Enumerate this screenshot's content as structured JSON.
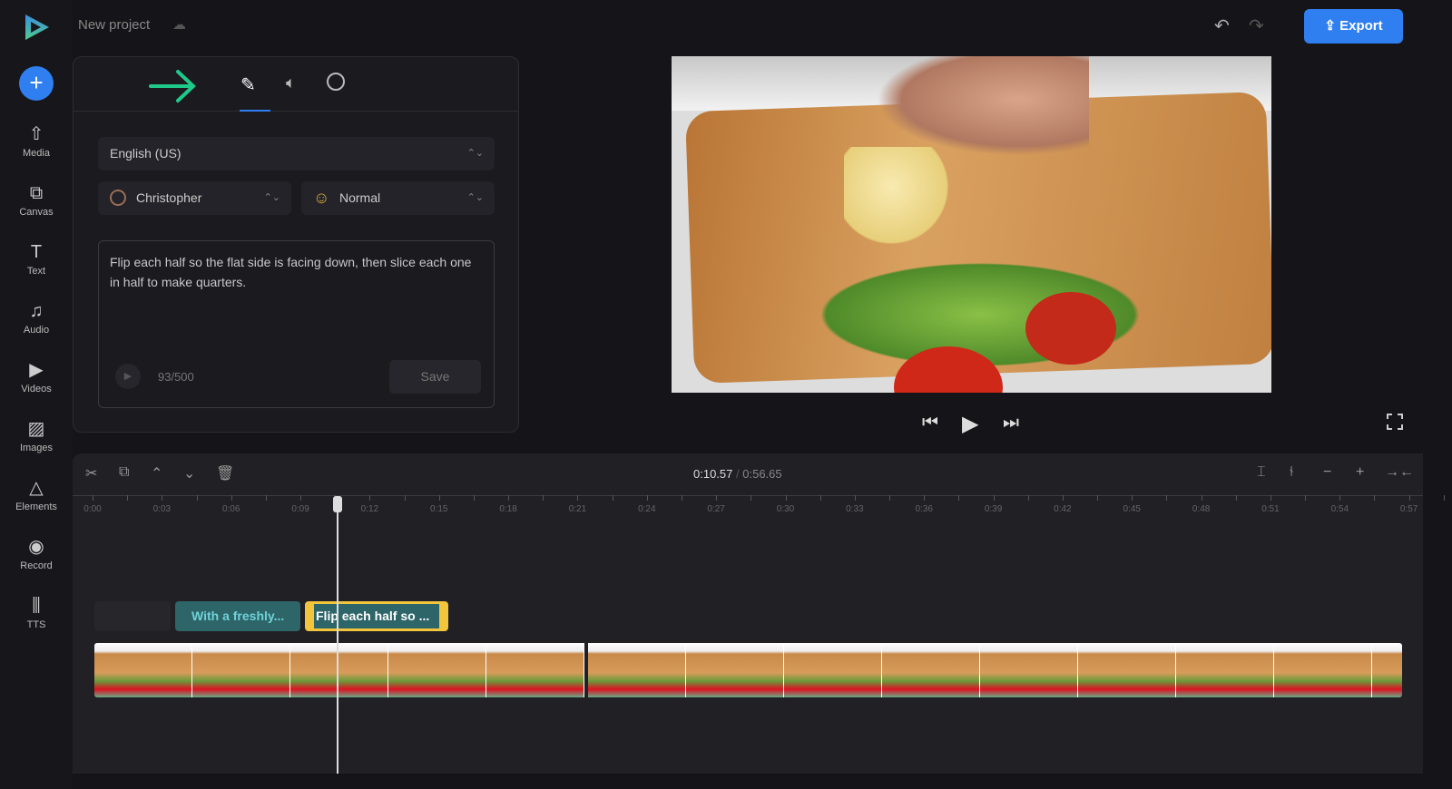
{
  "app": {
    "project_title": "New project",
    "export_label": "Export",
    "accent": "#2f7ff0"
  },
  "sidebar": {
    "items": [
      {
        "label": "Media",
        "icon": "cloud-upload-icon"
      },
      {
        "label": "Canvas",
        "icon": "canvas-icon"
      },
      {
        "label": "Text",
        "icon": "text-icon"
      },
      {
        "label": "Audio",
        "icon": "music-icon"
      },
      {
        "label": "Videos",
        "icon": "video-icon"
      },
      {
        "label": "Images",
        "icon": "image-icon"
      },
      {
        "label": "Elements",
        "icon": "shapes-icon"
      },
      {
        "label": "Record",
        "icon": "record-icon"
      },
      {
        "label": "TTS",
        "icon": "waveform-icon"
      }
    ]
  },
  "tts_panel": {
    "language": "English (US)",
    "voice": "Christopher",
    "style": "Normal",
    "text": "Flip each half so the flat side is facing down, then slice each one in half to make quarters.",
    "char_count": "93/500",
    "save_label": "Save"
  },
  "timeline": {
    "current_time": "0:10.57",
    "separator": "/",
    "total_time": "0:56.65",
    "ticks": [
      "0:00",
      "0:03",
      "0:06",
      "0:09",
      "0:12",
      "0:15",
      "0:18",
      "0:21",
      "0:24",
      "0:27",
      "0:30",
      "0:33",
      "0:36",
      "0:39",
      "0:42",
      "0:45",
      "0:48",
      "0:51",
      "0:54",
      "0:57"
    ],
    "clips": [
      {
        "label": "With a freshly..."
      },
      {
        "label": "Flip each half so ..."
      }
    ]
  }
}
